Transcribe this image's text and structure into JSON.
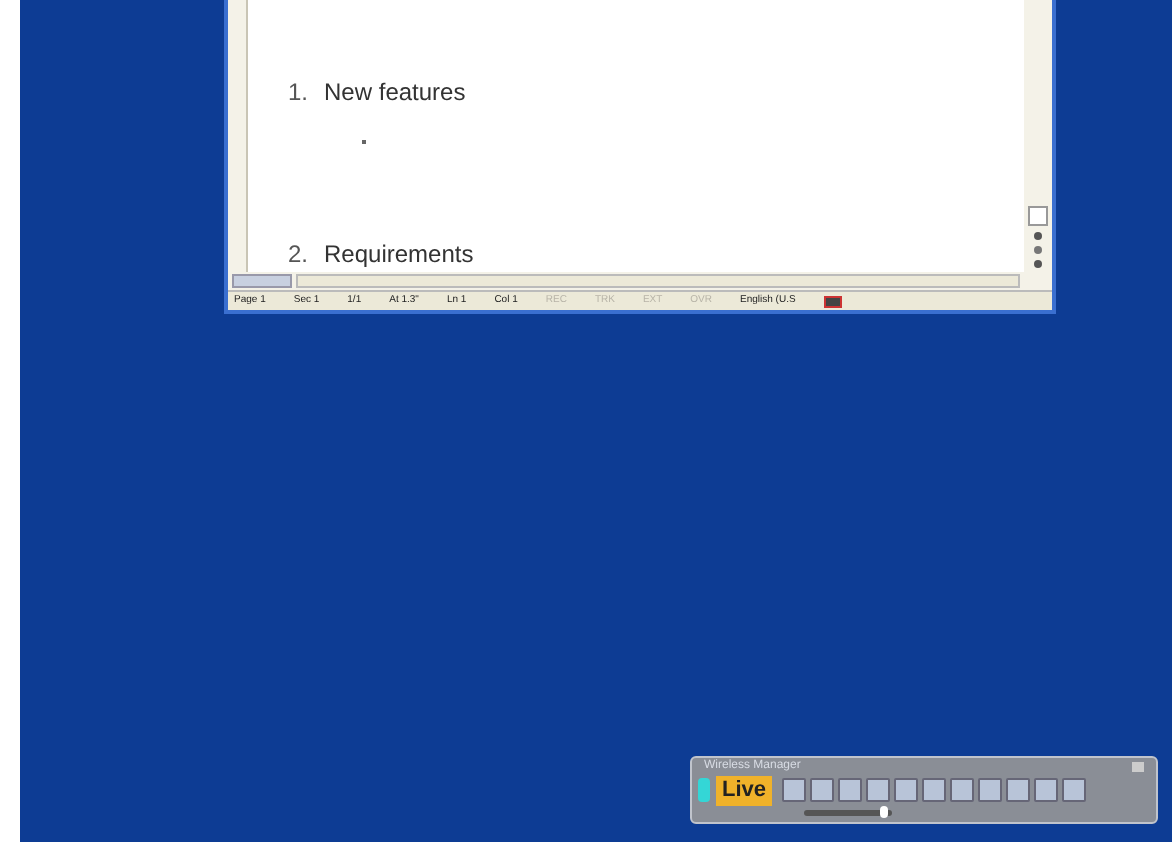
{
  "document": {
    "headings": [
      {
        "number": "1.",
        "text": "New features"
      },
      {
        "number": "2.",
        "text": "Requirements"
      }
    ]
  },
  "status_bar": [
    {
      "text": "Page 1",
      "disabled": false
    },
    {
      "text": "Sec 1",
      "disabled": false
    },
    {
      "text": "1/1",
      "disabled": false
    },
    {
      "text": "At 1.3\"",
      "disabled": false
    },
    {
      "text": "Ln 1",
      "disabled": false
    },
    {
      "text": "Col 1",
      "disabled": false
    },
    {
      "text": "REC",
      "disabled": true
    },
    {
      "text": "TRK",
      "disabled": true
    },
    {
      "text": "EXT",
      "disabled": true
    },
    {
      "text": "OVR",
      "disabled": true
    },
    {
      "text": "English (U.S",
      "disabled": false
    }
  ],
  "wireless_manager": {
    "title": "Wireless Manager",
    "live_button": "Live",
    "slider": {
      "level": 0.95
    }
  }
}
